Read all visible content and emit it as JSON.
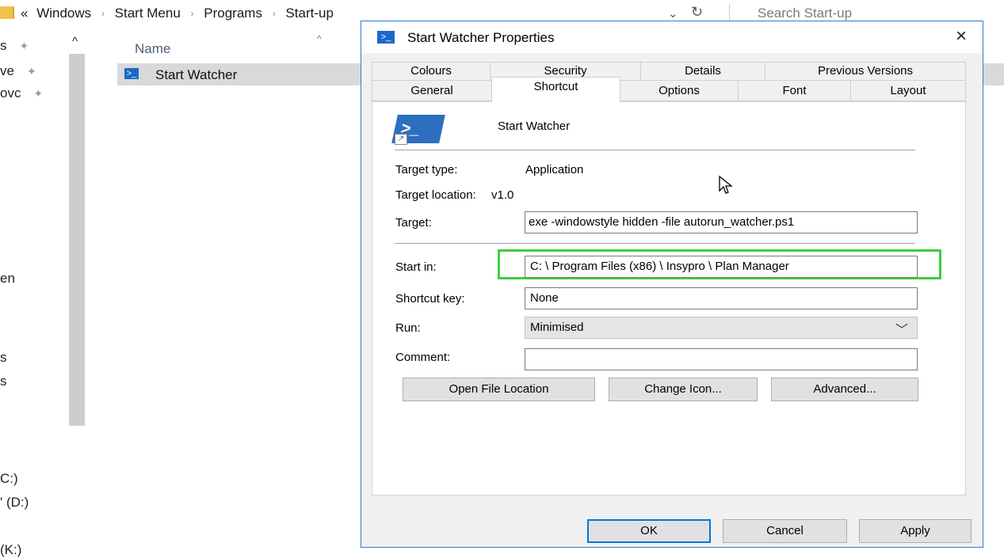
{
  "explorer": {
    "breadcrumb": {
      "prefix": "«",
      "items": [
        "Windows",
        "Start Menu",
        "Programs",
        "Start-up"
      ],
      "separator": "›"
    },
    "chevron": "⌄",
    "refresh": "↻",
    "search_placeholder": "Search Start-up",
    "nav_items": [
      {
        "label": "s",
        "pinned": true
      },
      {
        "label": "ve",
        "pinned": true
      },
      {
        "label": "ovc",
        "pinned": true
      },
      {
        "label": "en"
      },
      {
        "label": "s"
      },
      {
        "label": "s"
      },
      {
        "label": "C:)"
      },
      {
        "label": "' (D:)"
      },
      {
        "label": "(K:)"
      }
    ],
    "column_header": "Name",
    "files": [
      {
        "name": "Start Watcher"
      }
    ]
  },
  "dialog": {
    "title": "Start Watcher Properties",
    "close_glyph": "×",
    "tabs_back_row": [
      "Colours",
      "Security",
      "Details",
      "Previous Versions"
    ],
    "tabs_front_row": [
      "General",
      "Shortcut",
      "Options",
      "Font",
      "Layout"
    ],
    "active_tab": "Shortcut",
    "shortcut_name": "Start Watcher",
    "target_type_label": "Target type:",
    "target_type_value": "Application",
    "target_location_label": "Target location:",
    "target_location_value": "v1.0",
    "target_label": "Target:",
    "target_value": "exe -windowstyle hidden -file autorun_watcher.ps1",
    "start_in_label": "Start in:",
    "start_in_value": "C: \\ Program Files (x86) \\ Insypro \\ Plan Manager",
    "shortcut_key_label": "Shortcut key:",
    "shortcut_key_value": "None",
    "run_label": "Run:",
    "run_value": "Minimised",
    "comment_label": "Comment:",
    "comment_value": "",
    "buttons": {
      "open_file_location": "Open File Location",
      "change_icon": "Change Icon...",
      "advanced": "Advanced...",
      "ok": "OK",
      "cancel": "Cancel",
      "apply": "Apply"
    }
  },
  "colors": {
    "accent": "#0078d7",
    "highlight_box": "#3ccf3c",
    "selected_row": "#d9d9d9"
  }
}
